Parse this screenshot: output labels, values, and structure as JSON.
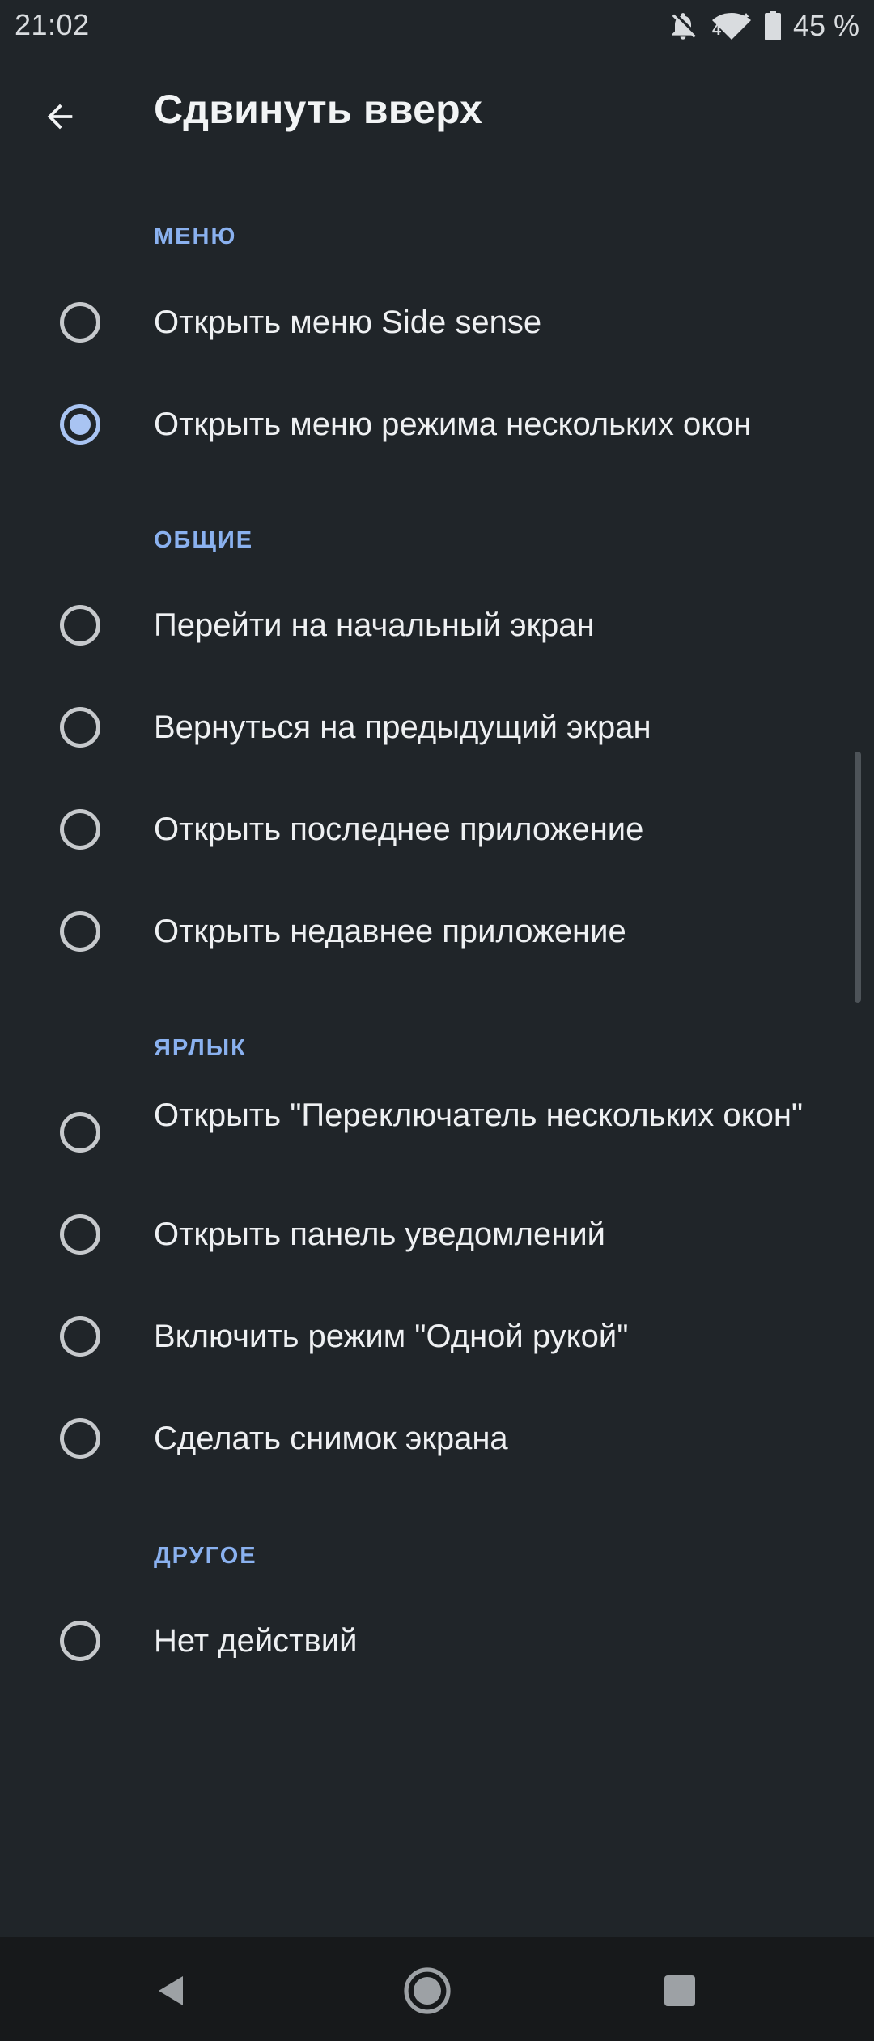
{
  "status_bar": {
    "time": "21:02",
    "battery_percent": "45 %",
    "network_label": "4",
    "icons": [
      "notifications-off-icon",
      "wifi-icon",
      "battery-icon"
    ]
  },
  "app_bar": {
    "back_icon": "arrow-back-icon",
    "title": "Сдвинуть вверх"
  },
  "sections": [
    {
      "header": "МЕНЮ",
      "options": [
        {
          "label": "Открыть меню Side sense",
          "selected": false
        },
        {
          "label": "Открыть меню режима нескольких окон",
          "selected": true
        }
      ]
    },
    {
      "header": "ОБЩИЕ",
      "options": [
        {
          "label": "Перейти на начальный экран",
          "selected": false
        },
        {
          "label": "Вернуться на предыдущий экран",
          "selected": false
        },
        {
          "label": "Открыть последнее приложение",
          "selected": false
        },
        {
          "label": "Открыть недавнее приложение",
          "selected": false
        }
      ]
    },
    {
      "header": "ЯРЛЫК",
      "options": [
        {
          "label": "Открыть \"Переключатель нескольких окон\"",
          "selected": false
        },
        {
          "label": "Открыть панель уведомлений",
          "selected": false
        },
        {
          "label": "Включить режим \"Одной рукой\"",
          "selected": false
        },
        {
          "label": "Сделать снимок экрана",
          "selected": false
        }
      ]
    },
    {
      "header": "ДРУГОЕ",
      "options": [
        {
          "label": "Нет действий",
          "selected": false
        }
      ]
    }
  ],
  "nav_bar": {
    "icons": [
      "nav-back-icon",
      "nav-home-icon",
      "nav-recents-icon"
    ]
  },
  "colors": {
    "background": "#202529",
    "accent": "#8ab1ef",
    "radio_selected": "#a9c4f2",
    "radio_unselected": "#c6c9cc",
    "text": "#eef0f2",
    "nav_bar": "#17191b"
  }
}
